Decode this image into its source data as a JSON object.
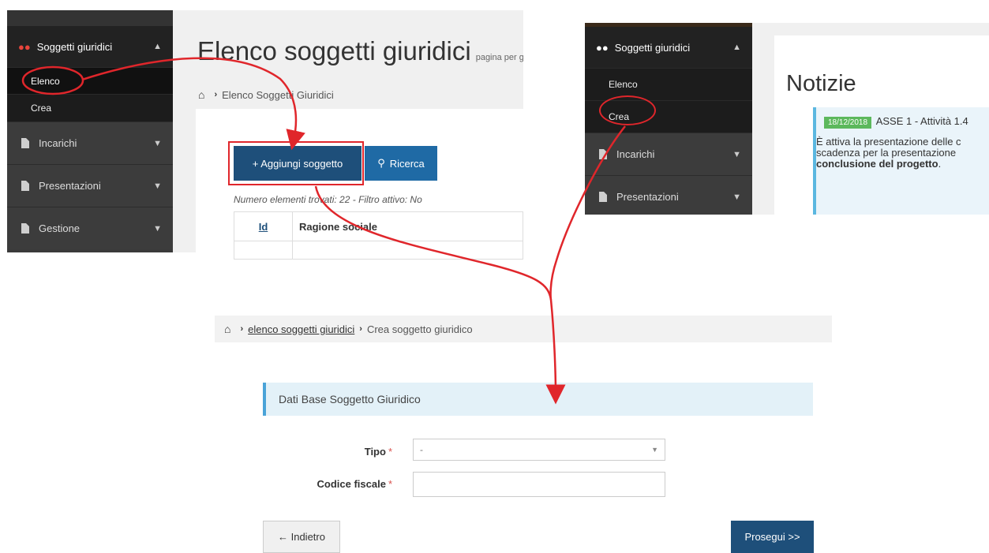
{
  "panel1": {
    "sidebar": {
      "section_label": "Soggetti giuridici",
      "submenu": [
        {
          "label": "Elenco",
          "active": true
        },
        {
          "label": "Crea",
          "active": false
        }
      ],
      "items": [
        {
          "label": "Incarichi"
        },
        {
          "label": "Presentazioni"
        },
        {
          "label": "Gestione"
        }
      ]
    },
    "main": {
      "title": "Elenco soggetti giuridici",
      "title_small": "pagina per g",
      "breadcrumb": "Elenco Soggetti Giuridici",
      "add_button": "+ Aggiungi soggetto",
      "search_button": "Ricerca",
      "count_text": "Numero elementi trovati: 22 - Filtro attivo: No",
      "table": {
        "columns": [
          "Id",
          "Ragione sociale"
        ]
      }
    }
  },
  "panel2": {
    "sidebar": {
      "section_label": "Soggetti giuridici",
      "submenu": [
        {
          "label": "Elenco"
        },
        {
          "label": "Crea"
        }
      ],
      "items": [
        {
          "label": "Incarichi"
        },
        {
          "label": "Presentazioni"
        }
      ]
    },
    "main": {
      "title": "Notizie",
      "news_date": "18/12/2018",
      "news_title": "ASSE 1 - Attività 1.4",
      "news_line1": "È attiva la presentazione delle c",
      "news_line2": "scadenza per la presentazione",
      "news_line3": "conclusione del progetto",
      "news_line3_end": "."
    }
  },
  "panel3": {
    "breadcrumb_link": "elenco soggetti giuridici",
    "breadcrumb_current": "Crea soggetto giuridico",
    "section_title": "Dati Base Soggetto Giuridico",
    "fields": {
      "tipo_label": "Tipo",
      "tipo_value": "-",
      "codice_label": "Codice fiscale",
      "required_mark": "*"
    },
    "back_button": "← Indietro",
    "next_button": "Prosegui >>"
  },
  "colors": {
    "accent": "#1e4f7a",
    "highlight": "#e0262b",
    "sidebar": "#3a3a3a"
  }
}
